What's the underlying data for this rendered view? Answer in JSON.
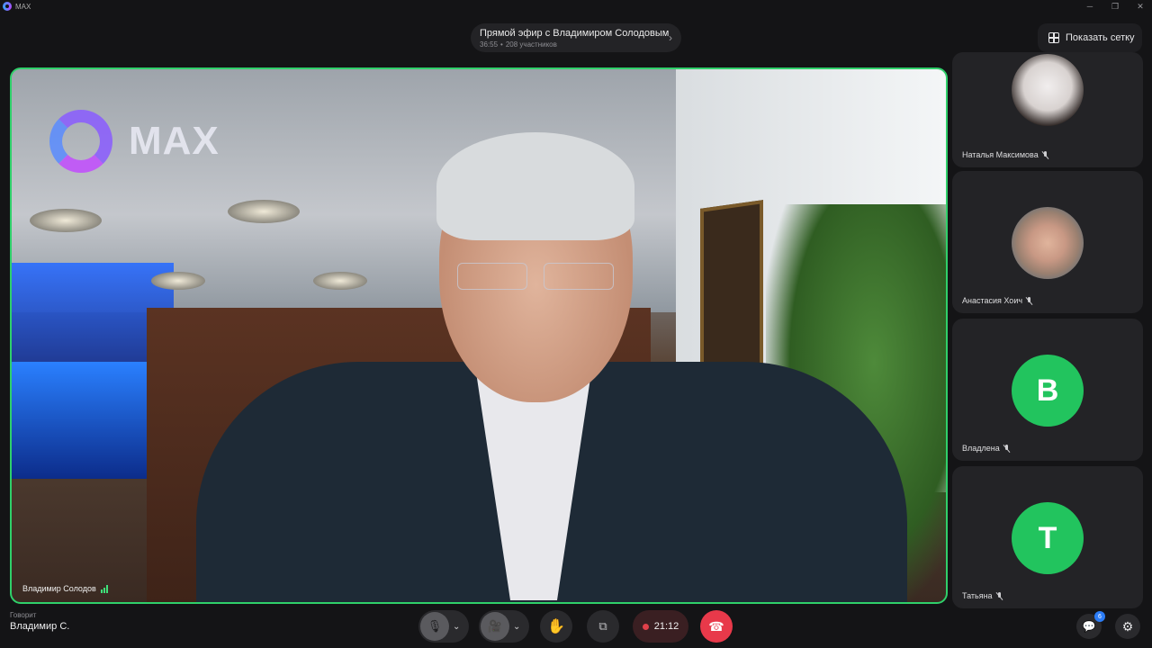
{
  "window": {
    "app_name": "MAX",
    "controls": {
      "minimize": "─",
      "restore": "❐",
      "close": "✕"
    }
  },
  "call": {
    "title": "Прямой эфир с Владимиром Солодовым",
    "duration": "36:55",
    "participants_count": "208 участников",
    "separator": "•"
  },
  "grid_button": {
    "label": "Показать сетку",
    "icon": "grid-icon"
  },
  "main_video": {
    "watermark": "MAX",
    "speaker_name": "Владимир Солодов",
    "border_color": "#2fd06a"
  },
  "participants": [
    {
      "name": "Наталья Максимова",
      "avatar_type": "photo",
      "mic": "muted"
    },
    {
      "name": "Анастасия Хоич",
      "avatar_type": "photo",
      "mic": "muted"
    },
    {
      "name": "Владлена",
      "avatar_type": "letter",
      "letter": "В",
      "mic": "muted",
      "color": "#22c45e"
    },
    {
      "name": "Татьяна",
      "avatar_type": "letter",
      "letter": "Т",
      "mic": "muted",
      "color": "#22c45e"
    }
  ],
  "speaking": {
    "caption": "Говорит",
    "name": "Владимир С."
  },
  "controls": {
    "mic_icon": "🎙",
    "cam_icon": "🎥",
    "chevron": "⌄",
    "hand_icon": "✋",
    "share_icon": "⧉",
    "record_time": "21:12",
    "end_icon": "☎",
    "end_color": "#e8394a"
  },
  "chat": {
    "badge": "6",
    "icon": "chat-icon"
  },
  "settings": {
    "icon": "gear-icon"
  }
}
